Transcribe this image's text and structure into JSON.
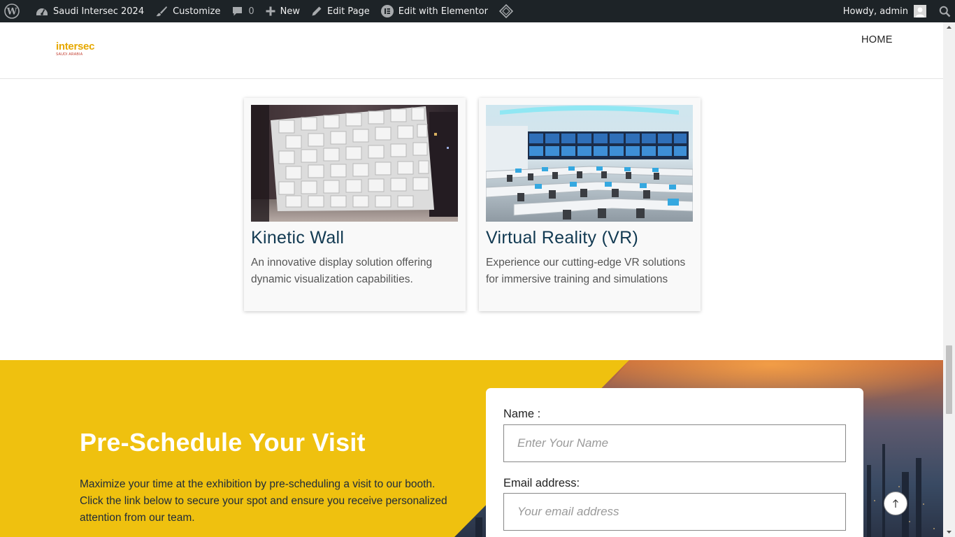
{
  "adminbar": {
    "wp_logo_icon": "wordpress-icon",
    "site_name": "Saudi Intersec 2024",
    "customize": "Customize",
    "comments_count": "0",
    "new": "New",
    "edit_page": "Edit Page",
    "edit_elementor": "Edit with Elementor",
    "howdy": "Howdy, admin"
  },
  "header": {
    "logo_main": "intersec",
    "logo_sub": "SAUDI ARABIA",
    "nav_home": "HOME"
  },
  "cards": [
    {
      "title": "Kinetic Wall",
      "description": "An innovative display solution offering dynamic visualization capabilities."
    },
    {
      "title": "Virtual Reality (VR)",
      "description": "Experience our cutting-edge VR solutions for immersive training and simulations"
    }
  ],
  "cta": {
    "title": "Pre-Schedule Your Visit",
    "text": "Maximize your time at the exhibition by pre-scheduling a visit to our booth. Click the link below to secure your spot and ensure you receive personalized attention from our team."
  },
  "form": {
    "name_label": "Name :",
    "name_placeholder": "Enter Your Name",
    "email_label": "Email address:",
    "email_placeholder": "Your email address"
  },
  "colors": {
    "adminbar": "#1d2327",
    "cta_yellow": "#efc10f",
    "card_title": "#123a52",
    "logo_yellow": "#e6a800"
  }
}
